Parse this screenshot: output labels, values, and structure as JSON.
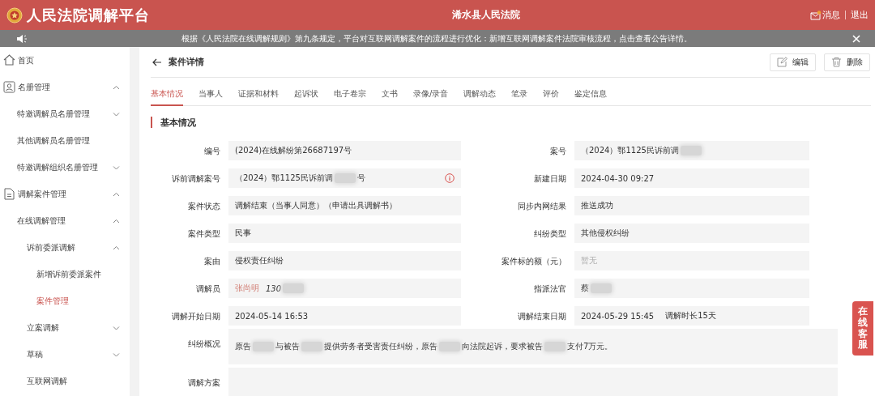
{
  "header": {
    "title": "人民法院调解平台",
    "court": "浠水县人民法院",
    "messages": {
      "label": "消息",
      "unread": true
    },
    "logout": "退出"
  },
  "notice": {
    "text": "根据《人民法院在线调解规则》第九条规定，平台对互联网调解案件的流程进行优化：新增互联网调解案件法院审核流程，点击查看公告详情。"
  },
  "sidebar": {
    "items": [
      {
        "label": "首页",
        "selected": false
      },
      {
        "label": "名册管理",
        "selected": false,
        "expanded": true,
        "children": [
          {
            "label": "特邀调解员名册管理",
            "selected": false,
            "expanded": false
          },
          {
            "label": "其他调解员名册管理",
            "selected": false
          },
          {
            "label": "特邀调解组织名册管理",
            "selected": false,
            "expanded": false
          }
        ]
      },
      {
        "label": "调解案件管理",
        "selected": false,
        "expanded": true,
        "children": [
          {
            "label": "在线调解管理",
            "selected": false,
            "expanded": true,
            "children": [
              {
                "label": "诉前委派调解",
                "selected": false,
                "expanded": true,
                "children": [
                  {
                    "label": "新增诉前委派案件",
                    "selected": false
                  },
                  {
                    "label": "案件管理",
                    "selected": true
                  }
                ]
              },
              {
                "label": "立案调解",
                "selected": false,
                "expanded": false
              },
              {
                "label": "草稿",
                "selected": false,
                "expanded": false
              },
              {
                "label": "互联网调解",
                "selected": false
              }
            ]
          }
        ]
      }
    ]
  },
  "page": {
    "title": "案件详情",
    "actions": [
      {
        "label": "编辑",
        "kind": "edit"
      },
      {
        "label": "删除",
        "kind": "delete"
      }
    ]
  },
  "tabs": [
    {
      "label": "基本情况",
      "selected": true
    },
    {
      "label": "当事人",
      "selected": false
    },
    {
      "label": "证据和材料",
      "selected": false
    },
    {
      "label": "起诉状",
      "selected": false
    },
    {
      "label": "电子卷宗",
      "selected": false
    },
    {
      "label": "文书",
      "selected": false
    },
    {
      "label": "录像/录音",
      "selected": false
    },
    {
      "label": "调解动态",
      "selected": false
    },
    {
      "label": "笔录",
      "selected": false
    },
    {
      "label": "评价",
      "selected": false
    },
    {
      "label": "鉴定信息",
      "selected": false
    }
  ],
  "section": {
    "title": "基本情况",
    "fields": [
      {
        "label": "编号",
        "parts": [
          {
            "kind": "text",
            "text": "(2024)在线解纷第26687197号"
          }
        ]
      },
      {
        "label": "案号",
        "parts": [
          {
            "kind": "text",
            "text": "（2024）鄂1125民诉前调"
          },
          {
            "kind": "redacted"
          }
        ]
      },
      {
        "label": "诉前调解案号",
        "info_icon": true,
        "parts": [
          {
            "kind": "text",
            "text": "（2024）鄂1125民诉前调"
          },
          {
            "kind": "redacted"
          },
          {
            "kind": "text",
            "text": "号"
          }
        ]
      },
      {
        "label": "新建日期",
        "parts": [
          {
            "kind": "text",
            "text": "2024-04-30 09:27"
          }
        ]
      },
      {
        "label": "案件状态",
        "parts": [
          {
            "kind": "text",
            "text": "调解结束（当事人同意）（申请出具调解书）"
          }
        ]
      },
      {
        "label": "同步内网结果",
        "parts": [
          {
            "kind": "text",
            "text": "推送成功"
          }
        ]
      },
      {
        "label": "案件类型",
        "parts": [
          {
            "kind": "text",
            "text": "民事"
          }
        ]
      },
      {
        "label": "纠纷类型",
        "parts": [
          {
            "kind": "text",
            "text": "其他侵权纠纷"
          }
        ]
      },
      {
        "label": "案由",
        "parts": [
          {
            "kind": "text",
            "text": "侵权责任纠纷"
          }
        ]
      },
      {
        "label": "案件标的额（元）",
        "parts": [
          {
            "kind": "muted",
            "text": "暂无"
          }
        ]
      },
      {
        "label": "调解员",
        "parts": [
          {
            "kind": "person",
            "text": "张尚明"
          },
          {
            "kind": "italic",
            "text": "130"
          },
          {
            "kind": "redacted"
          }
        ]
      },
      {
        "label": "指派法官",
        "parts": [
          {
            "kind": "text",
            "text": "蔡"
          },
          {
            "kind": "redacted"
          }
        ]
      },
      {
        "label": "调解开始日期",
        "parts": [
          {
            "kind": "text",
            "text": "2024-05-14 16:53"
          }
        ]
      },
      {
        "label": "调解结束日期",
        "parts": [
          {
            "kind": "text",
            "text": "2024-05-29 15:45"
          },
          {
            "kind": "note",
            "text": "调解时长15天"
          }
        ]
      },
      {
        "label": "纠纷概况",
        "wide": true,
        "parts": [
          {
            "kind": "text",
            "text": "原告"
          },
          {
            "kind": "redacted"
          },
          {
            "kind": "text",
            "text": "与被告"
          },
          {
            "kind": "redacted"
          },
          {
            "kind": "text",
            "text": "提供劳务者受害责任纠纷，原告"
          },
          {
            "kind": "redacted"
          },
          {
            "kind": "text",
            "text": "向法院起诉，要求被告"
          },
          {
            "kind": "redacted"
          },
          {
            "kind": "text",
            "text": "支付7万元。"
          }
        ]
      },
      {
        "label": "调解方案",
        "wide": true
      }
    ]
  },
  "service_tab": {
    "label": "在线客服"
  }
}
